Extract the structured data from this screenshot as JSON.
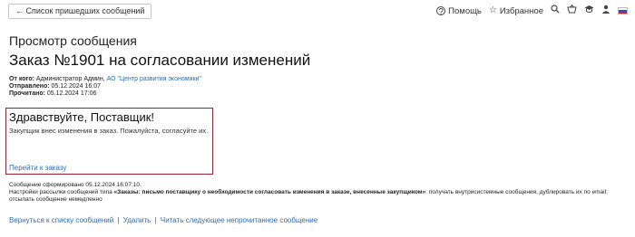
{
  "topbar": {
    "back_label": "← Список пришедших сообщений",
    "help_label": "Помощь",
    "favorites_label": "Избранное",
    "icons": [
      "help-icon",
      "star-icon",
      "search-icon",
      "basket-icon",
      "cap-icon",
      "profile-icon",
      "flag-icon"
    ]
  },
  "page_title": "Просмотр сообщения",
  "message": {
    "title": "Заказ №1901 на согласовании изменений",
    "from_label": "От кого:",
    "from_name": "Администратор Админ,",
    "from_org": "АО \"Центр развития экономики\"",
    "sent_label": "Отправлено:",
    "sent_value": "05.12.2024 16:07",
    "read_label": "Прочитано:",
    "read_value": "05.12.2024 17:06",
    "greeting": "Здравствуйте, Поставщик!",
    "body": "Закупщик внес изменения в заказ. Пожалуйста, согласуйте их.",
    "goto_link": "Перейти к заказу"
  },
  "footer": {
    "generated": "Сообщение сформировано 05.12.2024 16:07:10.",
    "settings_prefix": "Настройки рассылки сообщений типа ",
    "settings_type": "«Заказы: письмо поставщику о необходимости согласовать изменения в заказе, внесенные закупщиком»",
    "settings_suffix": ": получать внутрисистемные сообщения, дублировать их по email;",
    "settings_line2": "отсылать сообщение немедленно"
  },
  "actions": {
    "back_to_list": "Вернуться к списку сообщений",
    "delete": "Удалить",
    "read_next": "Читать следующее непрочитанное сообщение",
    "separator": "|"
  },
  "colors": {
    "link": "#2a6db5",
    "box_border": "#9b2230"
  }
}
